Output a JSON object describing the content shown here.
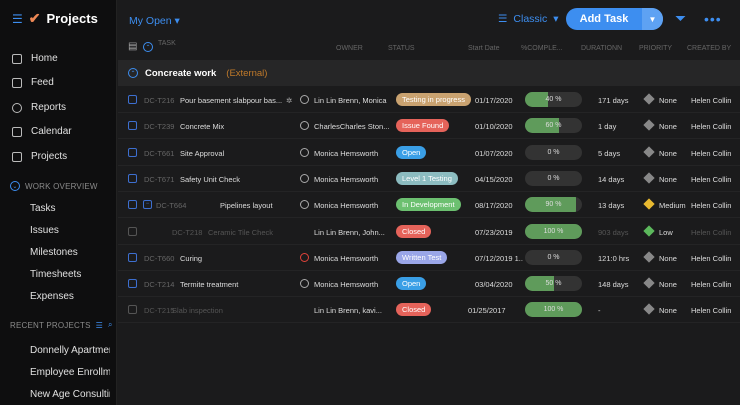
{
  "sidebar": {
    "title": "Projects",
    "nav": [
      "Home",
      "Feed",
      "Reports",
      "Calendar",
      "Projects"
    ],
    "work_overview": "WORK OVERVIEW",
    "work_items": [
      "Tasks",
      "Issues",
      "Milestones",
      "Timesheets",
      "Expenses"
    ],
    "recent_projects": "RECENT PROJECTS",
    "recent": [
      "Donnelly Apartments",
      "Employee Enrollment",
      "New Age Consulting"
    ]
  },
  "toolbar": {
    "view": "My Open",
    "layout": "Classic",
    "add_task": "Add Task"
  },
  "columns": {
    "task": "TASK",
    "owner": "OWNER",
    "status": "STATUS",
    "start": "Start Date",
    "complete": "%COMPLE...",
    "duration": "DURATIONN",
    "priority": "PRIORITY",
    "created": "CREATED BY"
  },
  "group": {
    "name": "Concreate work",
    "tag": "(External)"
  },
  "colors": {
    "accent": "#3d8ef0",
    "progress": "#5f9b5b"
  },
  "rows": [
    {
      "id": "DC-T216",
      "name": "Pour basement slabpour bas...",
      "owner": "Lin Lin Brenn, Monica",
      "status": "Testing in progress",
      "status_color": "#c9a270",
      "start": "01/17/2020",
      "pct": 40,
      "pct_label": "40 %",
      "duration": "171 days",
      "priority": "None",
      "created": "Helen Collin"
    },
    {
      "id": "DC-T239",
      "name": "Concrete Mix",
      "owner": "CharlesCharles Ston...",
      "status": "Issue Found",
      "status_color": "#e5635a",
      "start": "01/10/2020",
      "pct": 60,
      "pct_label": "60 %",
      "duration": "1 day",
      "priority": "None",
      "created": "Helen Collin"
    },
    {
      "id": "DC-T661",
      "name": "Site Approval",
      "owner": "Monica Hemsworth",
      "status": "Open",
      "status_color": "#3a9fe6",
      "start": "01/07/2020",
      "pct": 0,
      "pct_label": "0 %",
      "duration": "5 days",
      "priority": "None",
      "created": "Helen Collin"
    },
    {
      "id": "DC-T671",
      "name": "Safety Unit Check",
      "owner": "Monica Hemsworth",
      "status": "Level 1 Testing",
      "status_color": "#8cbcc0",
      "start": "04/15/2020",
      "pct": 0,
      "pct_label": "0 %",
      "duration": "14 days",
      "priority": "None",
      "created": "Helen Collin"
    },
    {
      "id": "DC-T664",
      "name": "Pipelines layout",
      "owner": "Monica Hemsworth",
      "status": "In Development",
      "status_color": "#6cc070",
      "start": "08/17/2020",
      "pct": 90,
      "pct_label": "90 %",
      "duration": "13 days",
      "priority": "Medium",
      "created": "Helen Collin"
    },
    {
      "id": "DC-T218",
      "name": "Ceramic Tile Check",
      "owner": "Lin Lin Brenn, John...",
      "status": "Closed",
      "status_color": "#e5635a",
      "start": "07/23/2019",
      "pct": 100,
      "pct_label": "100 %",
      "duration": "903 days",
      "priority": "Low",
      "created": "Helen Collin"
    },
    {
      "id": "DC-T660",
      "name": "Curing",
      "owner": "Monica Hemsworth",
      "status": "Written Test",
      "status_color": "#9aa6e8",
      "start": "07/12/2019 1..",
      "pct": 0,
      "pct_label": "0 %",
      "duration": "121:0 hrs",
      "priority": "None",
      "created": "Helen Collin"
    },
    {
      "id": "DC-T214",
      "name": "Termite treatment",
      "owner": "Monica Hemsworth",
      "status": "Open",
      "status_color": "#3a9fe6",
      "start": "03/04/2020",
      "pct": 50,
      "pct_label": "50 %",
      "duration": "148 days",
      "priority": "None",
      "created": "Helen Collin"
    },
    {
      "id": "DC-T215",
      "name": "Slab inspection",
      "owner": "Lin Lin Brenn, kavi...",
      "status": "Closed",
      "status_color": "#e5635a",
      "start": "01/25/2017",
      "pct": 100,
      "pct_label": "100 %",
      "duration": "-",
      "priority": "None",
      "created": "Helen Collin"
    }
  ]
}
